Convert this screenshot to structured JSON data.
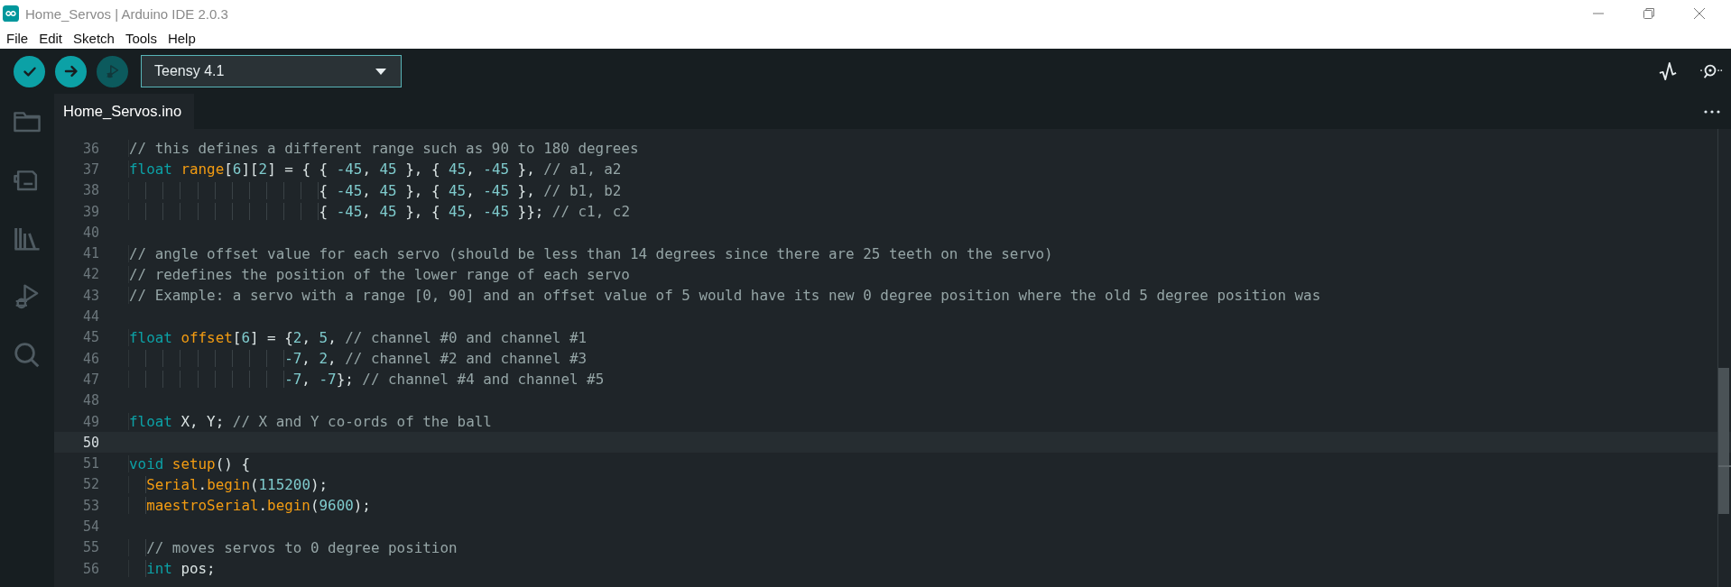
{
  "window": {
    "title": "Home_Servos | Arduino IDE 2.0.3"
  },
  "menu": [
    "File",
    "Edit",
    "Sketch",
    "Tools",
    "Help"
  ],
  "toolbar": {
    "buttons": [
      {
        "kind": "verify",
        "disabled": false
      },
      {
        "kind": "upload",
        "disabled": false
      },
      {
        "kind": "debug",
        "disabled": true
      }
    ],
    "board": "Teensy 4.1",
    "right": [
      {
        "kind": "plotter"
      },
      {
        "kind": "monitor"
      }
    ]
  },
  "tabs": [
    {
      "label": "Home_Servos.ino",
      "selected": true
    }
  ],
  "sidebar": {
    "items": [
      {
        "kind": "folder"
      },
      {
        "kind": "board"
      },
      {
        "kind": "library"
      },
      {
        "kind": "debug"
      },
      {
        "kind": "search"
      }
    ]
  },
  "editor": {
    "lines": [
      {
        "number": "36",
        "current": false,
        "tokens": [
          {
            "kind": "comment",
            "text": "// this defines a different range such as 90 to 180 degrees"
          }
        ]
      },
      {
        "number": "37",
        "current": false,
        "tokens": [
          {
            "kind": "keyword",
            "text": "float"
          },
          {
            "kind": "name",
            "text": " range"
          },
          {
            "kind": "plain",
            "text": "["
          },
          {
            "kind": "number",
            "text": "6"
          },
          {
            "kind": "plain",
            "text": "]["
          },
          {
            "kind": "number",
            "text": "2"
          },
          {
            "kind": "plain",
            "text": "] = { { "
          },
          {
            "kind": "number",
            "text": "-45"
          },
          {
            "kind": "plain",
            "text": ", "
          },
          {
            "kind": "number",
            "text": "45"
          },
          {
            "kind": "plain",
            "text": " }, { "
          },
          {
            "kind": "number",
            "text": "45"
          },
          {
            "kind": "plain",
            "text": ", "
          },
          {
            "kind": "number",
            "text": "-45"
          },
          {
            "kind": "plain",
            "text": " }, "
          },
          {
            "kind": "comment",
            "text": "// a1, a2"
          }
        ]
      },
      {
        "number": "38",
        "current": false,
        "tokens": [
          {
            "kind": "plain",
            "text": "                      { "
          },
          {
            "kind": "number",
            "text": "-45"
          },
          {
            "kind": "plain",
            "text": ", "
          },
          {
            "kind": "number",
            "text": "45"
          },
          {
            "kind": "plain",
            "text": " }, { "
          },
          {
            "kind": "number",
            "text": "45"
          },
          {
            "kind": "plain",
            "text": ", "
          },
          {
            "kind": "number",
            "text": "-45"
          },
          {
            "kind": "plain",
            "text": " }, "
          },
          {
            "kind": "comment",
            "text": "// b1, b2"
          }
        ]
      },
      {
        "number": "39",
        "current": false,
        "tokens": [
          {
            "kind": "plain",
            "text": "                      { "
          },
          {
            "kind": "number",
            "text": "-45"
          },
          {
            "kind": "plain",
            "text": ", "
          },
          {
            "kind": "number",
            "text": "45"
          },
          {
            "kind": "plain",
            "text": " }, { "
          },
          {
            "kind": "number",
            "text": "45"
          },
          {
            "kind": "plain",
            "text": ", "
          },
          {
            "kind": "number",
            "text": "-45"
          },
          {
            "kind": "plain",
            "text": " }}; "
          },
          {
            "kind": "comment",
            "text": "// c1, c2"
          }
        ]
      },
      {
        "number": "40",
        "current": false
      },
      {
        "number": "41",
        "current": false,
        "tokens": [
          {
            "kind": "comment",
            "text": "// angle offset value for each servo (should be less than 14 degrees since there are 25 teeth on the servo)"
          }
        ]
      },
      {
        "number": "42",
        "current": false,
        "tokens": [
          {
            "kind": "comment",
            "text": "// redefines the position of the lower range of each servo"
          }
        ]
      },
      {
        "number": "43",
        "current": false,
        "tokens": [
          {
            "kind": "comment",
            "text": "// Example: a servo with a range [0, 90] and an offset value of 5 would have its new 0 degree position where the old 5 degree position was"
          }
        ]
      },
      {
        "number": "44",
        "current": false
      },
      {
        "number": "45",
        "current": false,
        "tokens": [
          {
            "kind": "keyword",
            "text": "float"
          },
          {
            "kind": "name",
            "text": " offset"
          },
          {
            "kind": "plain",
            "text": "["
          },
          {
            "kind": "number",
            "text": "6"
          },
          {
            "kind": "plain",
            "text": "] = {"
          },
          {
            "kind": "number",
            "text": "2"
          },
          {
            "kind": "plain",
            "text": ", "
          },
          {
            "kind": "number",
            "text": "5"
          },
          {
            "kind": "plain",
            "text": ", "
          },
          {
            "kind": "comment",
            "text": "// channel #0 and channel #1"
          }
        ]
      },
      {
        "number": "46",
        "current": false,
        "tokens": [
          {
            "kind": "number",
            "text": "                  -7"
          },
          {
            "kind": "plain",
            "text": ", "
          },
          {
            "kind": "number",
            "text": "2"
          },
          {
            "kind": "plain",
            "text": ", "
          },
          {
            "kind": "comment",
            "text": "// channel #2 and channel #3"
          }
        ]
      },
      {
        "number": "47",
        "current": false,
        "tokens": [
          {
            "kind": "number",
            "text": "                  -7"
          },
          {
            "kind": "plain",
            "text": ", "
          },
          {
            "kind": "number",
            "text": "-7"
          },
          {
            "kind": "plain",
            "text": "}; "
          },
          {
            "kind": "comment",
            "text": "// channel #4 and channel #5"
          }
        ]
      },
      {
        "number": "48",
        "current": false
      },
      {
        "number": "49",
        "current": false,
        "tokens": [
          {
            "kind": "keyword",
            "text": "float"
          },
          {
            "kind": "plain",
            "text": " X, Y; "
          },
          {
            "kind": "comment",
            "text": "// X and Y co-ords of the ball"
          }
        ]
      },
      {
        "number": "50",
        "current": true
      },
      {
        "number": "51",
        "current": false,
        "tokens": [
          {
            "kind": "keyword",
            "text": "void"
          },
          {
            "kind": "name",
            "text": " setup"
          },
          {
            "kind": "plain",
            "text": "() {"
          }
        ]
      },
      {
        "number": "52",
        "current": false,
        "tokens": [
          {
            "kind": "name",
            "text": "  Serial"
          },
          {
            "kind": "plain",
            "text": "."
          },
          {
            "kind": "name",
            "text": "begin"
          },
          {
            "kind": "plain",
            "text": "("
          },
          {
            "kind": "number",
            "text": "115200"
          },
          {
            "kind": "plain",
            "text": ");"
          }
        ]
      },
      {
        "number": "53",
        "current": false,
        "tokens": [
          {
            "kind": "name",
            "text": "  maestroSerial"
          },
          {
            "kind": "plain",
            "text": "."
          },
          {
            "kind": "name",
            "text": "begin"
          },
          {
            "kind": "plain",
            "text": "("
          },
          {
            "kind": "number",
            "text": "9600"
          },
          {
            "kind": "plain",
            "text": ");"
          }
        ]
      },
      {
        "number": "54",
        "current": false
      },
      {
        "number": "55",
        "current": false,
        "tokens": [
          {
            "kind": "comment",
            "text": "  // moves servos to 0 degree position"
          }
        ]
      },
      {
        "number": "56",
        "current": false,
        "tokens": [
          {
            "kind": "keyword",
            "text": "  int"
          },
          {
            "kind": "plain",
            "text": " pos;"
          }
        ]
      }
    ]
  }
}
